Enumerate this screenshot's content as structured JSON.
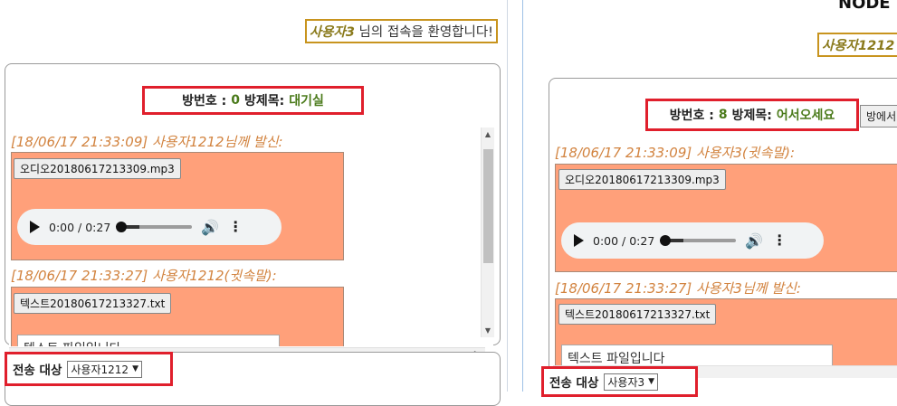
{
  "left": {
    "welcome": {
      "user": "사용자3",
      "message": " 님의 접속을 환영합니다!"
    },
    "room": {
      "num_label": "방번호 :",
      "num": "0",
      "title_label": "방제목:",
      "title": "대기실"
    },
    "messages": [
      {
        "meta": "[18/06/17 21:33:09] 사용자1212님께 발신:",
        "file": "오디오20180617213309.mp3",
        "audio_time": "0:00 / 0:27"
      },
      {
        "meta": "[18/06/17 21:33:27] 사용자1212(귓속말):",
        "file": "텍스트20180617213327.txt",
        "text_preview": "텍스트 파일입니다"
      }
    ],
    "send_target": {
      "label": "전송 대상",
      "selected": "사용자1212"
    }
  },
  "right": {
    "header": "NODE",
    "welcome_user": "사용자1212",
    "room": {
      "num_label": "방번호 :",
      "num": "8",
      "title_label": "방제목:",
      "title": "어서오세요"
    },
    "room_button": "방에서",
    "messages": [
      {
        "meta": "[18/06/17 21:33:09] 사용자3(귓속말):",
        "file": "오디오20180617213309.mp3",
        "audio_time": "0:00 / 0:27"
      },
      {
        "meta": "[18/06/17 21:33:27] 사용자3님께 발신:",
        "file": "텍스트20180617213327.txt",
        "text_preview": "텍스트 파일입니다"
      }
    ],
    "send_target": {
      "label": "전송 대상",
      "selected": "사용자3"
    }
  },
  "colors": {
    "highlight": "#e01f2c",
    "bubble": "#ffa07a",
    "meta_text": "#d2833f",
    "welcome_border": "#c8941e",
    "room_value": "#4a7a1a"
  }
}
